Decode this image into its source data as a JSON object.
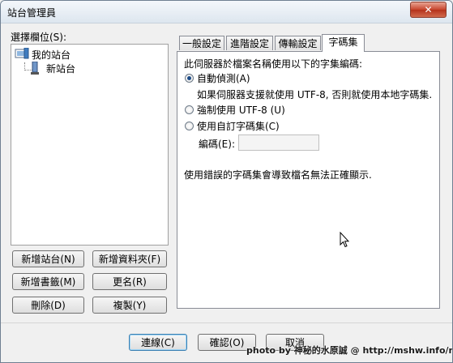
{
  "window": {
    "title": "站台管理員",
    "close_label": "✕"
  },
  "left": {
    "select_label": "選擇欄位(S):",
    "tree": {
      "root": "我的站台",
      "child": "新站台"
    },
    "buttons": {
      "new_site": "新增站台(N)",
      "new_folder": "新增資料夾(F)",
      "new_bookmark": "新增書籤(M)",
      "rename": "更名(R)",
      "delete": "刪除(D)",
      "duplicate": "複製(Y)"
    }
  },
  "tabs": [
    "一般設定",
    "進階設定",
    "傳輸設定",
    "字碼集"
  ],
  "charset": {
    "intro": "此伺服器於檔案名稱使用以下的字集編碼:",
    "auto_detect": "自動偵測(A)",
    "auto_desc": "如果伺服器支援就使用 UTF-8, 否則就使用本地字碼集.",
    "force_utf8": "強制使用 UTF-8 (U)",
    "custom": "使用自訂字碼集(C)",
    "encoding_label": "編碼(E):",
    "encoding_value": "",
    "warning": "使用錯誤的字碼集會導致檔名無法正確顯示.",
    "selected": "auto_detect"
  },
  "footer": {
    "connect": "連線(C)",
    "ok": "確認(O)",
    "cancel": "取消"
  },
  "watermark": "photo by 神秘的水原誠 @ http://mshw.info/mshw"
}
